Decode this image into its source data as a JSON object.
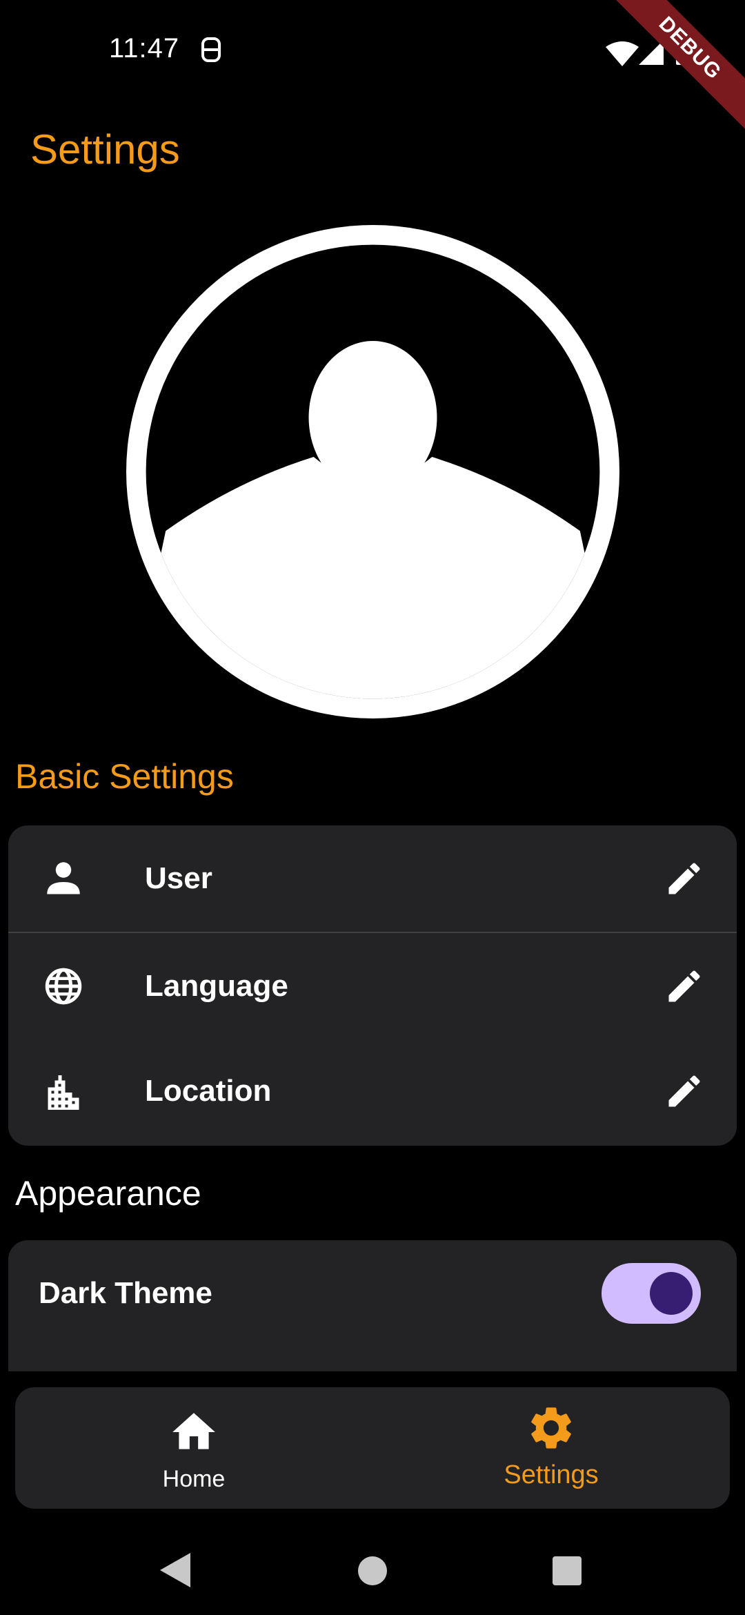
{
  "status_bar": {
    "time": "11:47",
    "notification_icon": "notification-icon",
    "wifi_icon": "wifi-icon",
    "signal_icon": "signal-icon",
    "battery_icon": "battery-icon"
  },
  "debug_banner": "DEBUG",
  "app_bar": {
    "title": "Settings"
  },
  "avatar": {
    "icon": "account-circle-icon"
  },
  "basic_settings": {
    "title": "Basic Settings",
    "items": [
      {
        "label": "User",
        "icon": "person-icon",
        "action_icon": "edit-icon"
      },
      {
        "label": "Language",
        "icon": "globe-icon",
        "action_icon": "edit-icon"
      },
      {
        "label": "Location",
        "icon": "city-icon",
        "action_icon": "edit-icon"
      }
    ]
  },
  "appearance": {
    "title": "Appearance",
    "dark_theme_label": "Dark Theme",
    "dark_theme_enabled": true
  },
  "bottom_nav": {
    "items": [
      {
        "label": "Home",
        "icon": "home-icon",
        "active": false
      },
      {
        "label": "Settings",
        "icon": "settings-icon",
        "active": true
      }
    ]
  },
  "colors": {
    "accent": "#f49b1c",
    "background": "#000000",
    "card": "#232325",
    "toggle_track": "#d0bcff",
    "toggle_thumb": "#381e72",
    "debug_banner": "#7a1a1e"
  },
  "system_nav": {
    "back_icon": "back-triangle-icon",
    "home_icon": "home-circle-icon",
    "recents_icon": "recents-square-icon"
  }
}
